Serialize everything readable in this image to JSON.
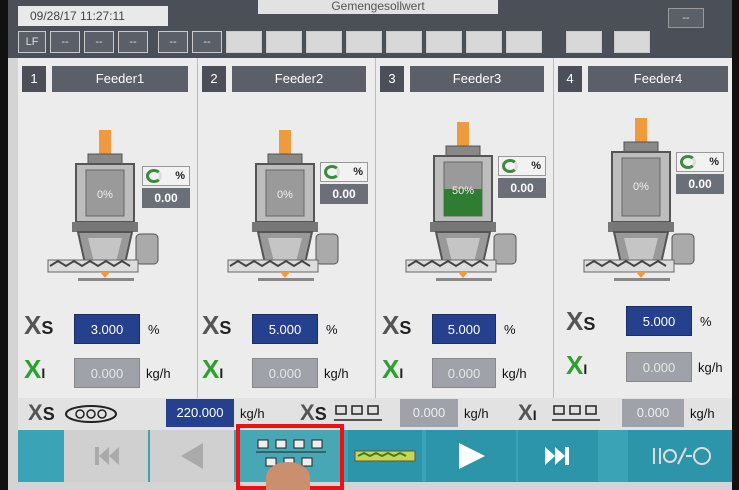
{
  "header": {
    "datetime": "09/28/17 11:27:11",
    "title_partial": "Gemengesollwert",
    "line_label": "LF",
    "slot_dash": "--",
    "right_dash": "--"
  },
  "feeders": [
    {
      "number": "1",
      "name": "Feeder1",
      "hopper_fill": "0%",
      "fill_fraction": 0.0,
      "rate_pct_label": "%",
      "rate_value": "0.00",
      "xs_value": "3.000",
      "xs_unit": "%",
      "xi_value": "0.000",
      "xi_unit": "kg/h"
    },
    {
      "number": "2",
      "name": "Feeder2",
      "hopper_fill": "0%",
      "fill_fraction": 0.0,
      "rate_pct_label": "%",
      "rate_value": "0.00",
      "xs_value": "5.000",
      "xs_unit": "%",
      "xi_value": "0.000",
      "xi_unit": "kg/h"
    },
    {
      "number": "3",
      "name": "Feeder3",
      "hopper_fill": "50%",
      "fill_fraction": 0.5,
      "rate_pct_label": "%",
      "rate_value": "0.00",
      "xs_value": "5.000",
      "xs_unit": "%",
      "xi_value": "0.000",
      "xi_unit": "kg/h"
    },
    {
      "number": "4",
      "name": "Feeder4",
      "hopper_fill": "0%",
      "fill_fraction": 0.0,
      "rate_pct_label": "%",
      "rate_value": "0.00",
      "xs_value": "5.000",
      "xs_unit": "%",
      "xi_value": "0.000",
      "xi_unit": "kg/h"
    }
  ],
  "labels": {
    "x": "X",
    "s": "S",
    "i": "I"
  },
  "summary": {
    "total_setpoint": "220.000",
    "total_setpoint_unit": "kg/h",
    "sum_setpoint": "0.000",
    "sum_setpoint_unit": "kg/h",
    "sum_actual": "0.000",
    "sum_actual_unit": "kg/h"
  },
  "nav": {
    "buttons": [
      "first-page",
      "previous",
      "feeder-overview",
      "conveyor",
      "play",
      "next-page",
      "system"
    ],
    "selected": "feeder-overview"
  },
  "colors": {
    "setpoint_bg": "#25408c",
    "actual_bg": "#9fa3a9",
    "nav_teal": "#3aa3b5",
    "fill_green": "#2e7d32",
    "motor_orange": "#f09a3e",
    "highlight": "#ee1111"
  }
}
